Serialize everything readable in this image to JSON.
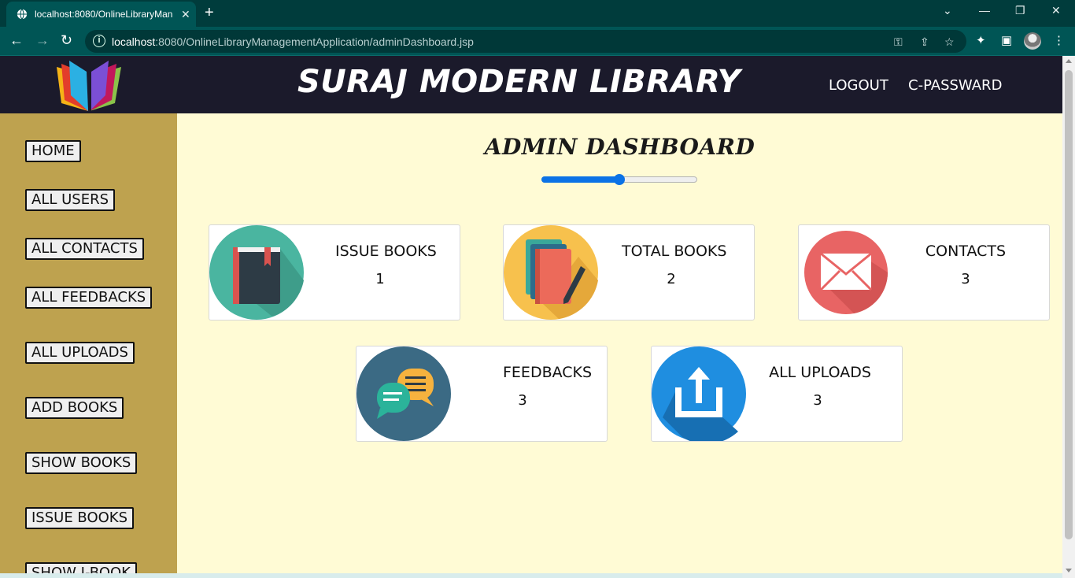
{
  "browser": {
    "tab_title": "localhost:8080/OnlineLibraryMan",
    "tab_close": "✕",
    "new_tab": "+",
    "url_host": "localhost",
    "url_rest": ":8080/OnlineLibraryManagementApplication/adminDashboard.jsp",
    "controls": {
      "dropdown": "⌄",
      "minimize": "—",
      "restore": "❐",
      "close": "✕"
    }
  },
  "header": {
    "title": "SURAJ MODERN LIBRARY",
    "logout": "LOGOUT",
    "change_password": "C-PASSWARD"
  },
  "sidebar": {
    "items": [
      {
        "label": "HOME"
      },
      {
        "label": "ALL USERS"
      },
      {
        "label": "ALL CONTACTS"
      },
      {
        "label": "ALL FEEDBACKS"
      },
      {
        "label": "ALL UPLOADS"
      },
      {
        "label": "ADD BOOKS"
      },
      {
        "label": "SHOW BOOKS"
      },
      {
        "label": "ISSUE BOOKS"
      },
      {
        "label": "SHOW I-BOOK"
      }
    ]
  },
  "main": {
    "title": "ADMIN DASHBOARD",
    "slider_value": 0.5,
    "cards": [
      {
        "label": "ISSUE BOOKS",
        "count": "1"
      },
      {
        "label": "TOTAL BOOKS",
        "count": "2"
      },
      {
        "label": "CONTACTS",
        "count": "3"
      },
      {
        "label": "FEEDBACKS",
        "count": "3"
      },
      {
        "label": "ALL UPLOADS",
        "count": "3"
      }
    ]
  },
  "colors": {
    "header_bg": "#1b1a2b",
    "sidebar_bg": "#bea24f",
    "main_bg": "#fffbd5",
    "accent": "#0b72e6"
  }
}
